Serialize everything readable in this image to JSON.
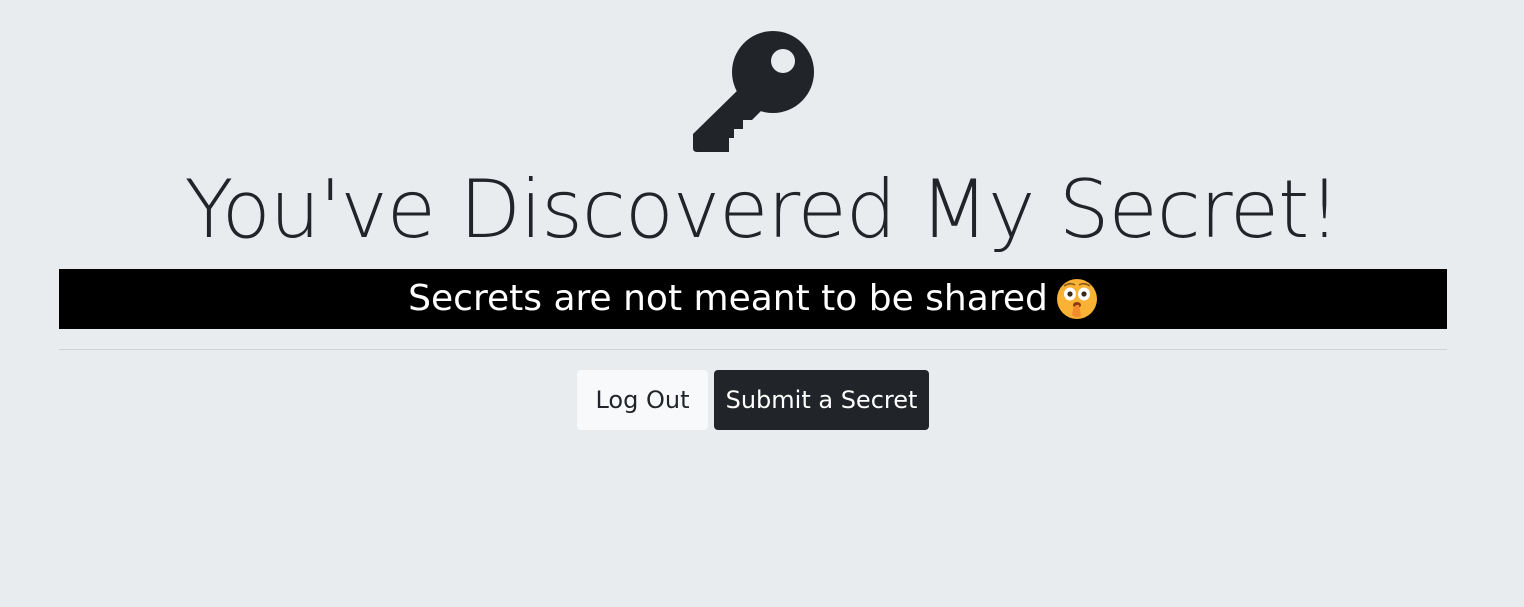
{
  "header": {
    "icon": "key-icon",
    "title": "You've Discovered My Secret!"
  },
  "banner": {
    "text": "Secrets are not meant to be shared",
    "emoji": "shushing-face-icon"
  },
  "actions": {
    "logout_label": "Log Out",
    "submit_label": "Submit a Secret"
  },
  "colors": {
    "background": "#e8ecef",
    "banner_bg": "#000000",
    "text_dark": "#212529",
    "button_light": "#f8f9fa",
    "button_dark": "#212529"
  }
}
